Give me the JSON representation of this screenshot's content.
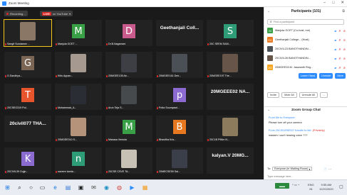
{
  "window": {
    "title": "Zoom Meeting"
  },
  "meeting": {
    "recording_label": "Recording...",
    "live_label": "LIVE",
    "live_dest": "on YouTube",
    "tiles": [
      {
        "row": 0,
        "col": 0,
        "type": "photo",
        "color": "#8a7765",
        "label": "Sangit Sundaram ...",
        "active": true
      },
      {
        "row": 0,
        "col": 1,
        "type": "letter",
        "letter": "M",
        "color": "#3aa048",
        "label": "Manjula GCET ..."
      },
      {
        "row": 0,
        "col": 2,
        "type": "letter",
        "letter": "D",
        "color": "#c95b8c",
        "label": "Dr.B.Nagamani"
      },
      {
        "row": 0,
        "col": 3,
        "type": "text",
        "text": "Geethanjali Coll...",
        "label": ""
      },
      {
        "row": 0,
        "col": 4,
        "type": "letter",
        "letter": "S",
        "color": "#2e9d77",
        "label": "20C SEEM SAM..."
      },
      {
        "row": 1,
        "col": 0,
        "type": "letter",
        "letter": "G",
        "color": "#7b6555",
        "label": "G.Sandhya..."
      },
      {
        "row": 1,
        "col": 1,
        "type": "photo",
        "color": "#a69a90",
        "label": "Kittu Appan..."
      },
      {
        "row": 1,
        "col": 2,
        "type": "photo",
        "color": "#3d3f45",
        "label": "20MGEE135 Ab..."
      },
      {
        "row": 1,
        "col": 3,
        "type": "photo",
        "color": "#4a5055",
        "label": "20MGEE161 Deir..."
      },
      {
        "row": 1,
        "col": 4,
        "type": "photo",
        "color": "#665548",
        "label": "20MGEE197 The..."
      },
      {
        "row": 2,
        "col": 0,
        "type": "letter",
        "letter": "T",
        "color": "#e8552d",
        "label": "20CSEO319 Pol..."
      },
      {
        "row": 2,
        "col": 1,
        "type": "photo",
        "color": "#2a2d33",
        "label": "Mohammad_A..."
      },
      {
        "row": 2,
        "col": 2,
        "type": "photo",
        "color": "#464a4c",
        "label": "Arun Teja S..."
      },
      {
        "row": 2,
        "col": 3,
        "type": "letter",
        "letter": "p",
        "color": "#8b6bd0",
        "label": "Potla Soumyasri..."
      },
      {
        "row": 2,
        "col": 4,
        "type": "text",
        "text": "20MGEEE02 NA...",
        "label": ""
      },
      {
        "row": 3,
        "col": 0,
        "type": "text",
        "text": "20civil077 THA...",
        "label": ""
      },
      {
        "row": 3,
        "col": 1,
        "type": "photo",
        "color": "#b4937a",
        "label": "20MGEE010 S..."
      },
      {
        "row": 3,
        "col": 2,
        "type": "letter",
        "letter": "M",
        "color": "#3aa048",
        "label": "Manasa Vemula"
      },
      {
        "row": 3,
        "col": 3,
        "type": "letter",
        "letter": "B",
        "color": "#e8781f",
        "label": "Bhavitha Kris..."
      },
      {
        "row": 3,
        "col": 4,
        "type": "photo",
        "color": "#8d7b5e",
        "label": "20C1B P96m N..."
      },
      {
        "row": 4,
        "col": 0,
        "type": "letter",
        "letter": "K",
        "color": "#8b6bd0",
        "label": "20CIVIL39 Gujjn..."
      },
      {
        "row": 4,
        "col": 1,
        "type": "letter",
        "letter": "n",
        "color": "#2e9d77",
        "label": "naveen tamta..."
      },
      {
        "row": 4,
        "col": 2,
        "type": "photo",
        "color": "#c7c1b5",
        "label": "20CSE CSVE TA..."
      },
      {
        "row": 4,
        "col": 3,
        "type": "photo",
        "color": "#3a3f49",
        "label": "20MECSE59 Sai..."
      },
      {
        "row": 4,
        "col": 4,
        "type": "text",
        "text": "kalyan.V 20MG...",
        "label": ""
      }
    ]
  },
  "participants": {
    "title": "Participants (101)",
    "search_placeholder": "Find a participant",
    "list": [
      {
        "initial": "M",
        "color": "#3aa048",
        "name": "Manjula GCET (Co-host, me)"
      },
      {
        "initial": "GC",
        "color": "#e8781f",
        "name": "Geethanjali College... (Host)"
      },
      {
        "initial": "",
        "color": "#4a5055",
        "name": "20CIVIL23 BANOTHANDIN..."
      },
      {
        "initial": "",
        "color": "#665548",
        "name": "20CIVIL26 BANOTHANDIN..."
      },
      {
        "initial": "2G",
        "color": "#f5a623",
        "name": "20MGEE33.M. Jaswanth Reg..."
      }
    ],
    "buttons_row1": [
      "Lower Hand",
      "Unmute",
      "More"
    ],
    "buttons_row2": [
      "Invite",
      "Mute All",
      "Unmute All",
      "..."
    ]
  },
  "chat": {
    "title": "Zoom Group Chat",
    "messages": [
      {
        "from": "From Me to Everyone:",
        "text": "Please turn off your camera"
      },
      {
        "from": "From 20C001RMS37 Karuthi to Me:",
        "tag": "(Privately)",
        "text": "madam i can't hearing voice ???"
      }
    ],
    "to_label": "To:",
    "to_value": "Everyone (in Waiting Room)",
    "input_placeholder": "Type message here..."
  },
  "taskbar": {
    "lang": "ENG",
    "lang2": "IN",
    "time": "9:55 AM",
    "date": "11/20/2020"
  }
}
